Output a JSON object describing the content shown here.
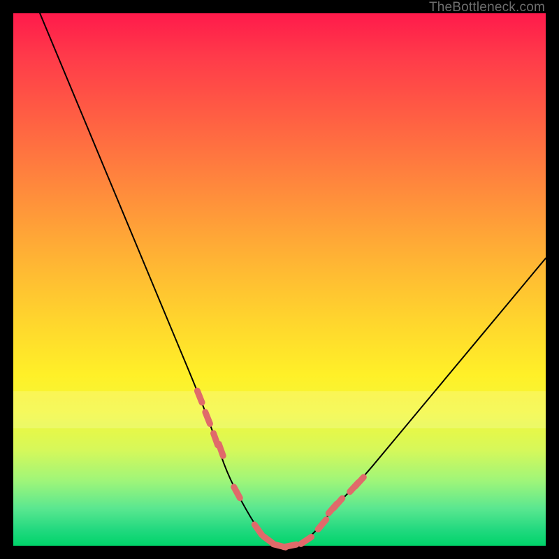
{
  "watermark": "TheBottleneck.com",
  "colors": {
    "frame": "#000000",
    "curve": "#000000",
    "marker": "#e06a6a",
    "gradient_top": "#ff1a4b",
    "gradient_bottom": "#00d46a"
  },
  "chart_data": {
    "type": "line",
    "title": "",
    "xlabel": "",
    "ylabel": "",
    "xlim": [
      0,
      100
    ],
    "ylim": [
      0,
      100
    ],
    "grid": false,
    "legend": false,
    "series": [
      {
        "name": "bottleneck-curve",
        "x": [
          5,
          10,
          15,
          20,
          25,
          30,
          35,
          38,
          40,
          43,
          46,
          48,
          50,
          52,
          55,
          58,
          60,
          65,
          70,
          75,
          80,
          85,
          90,
          95,
          100
        ],
        "y": [
          100,
          88,
          76,
          64,
          52,
          40,
          28,
          20,
          14,
          8,
          3,
          1,
          0,
          0,
          1,
          4,
          7,
          12,
          18,
          24,
          30,
          36,
          42,
          48,
          54
        ]
      }
    ],
    "markers": {
      "name": "highlight-points",
      "x": [
        35,
        36.5,
        38,
        39,
        42,
        46,
        48,
        50,
        52,
        55,
        58,
        60,
        61,
        64,
        65
      ],
      "y": [
        28,
        24,
        20,
        18,
        10,
        3,
        1,
        0,
        0,
        1,
        4,
        7,
        8,
        11,
        12
      ]
    },
    "pale_band": {
      "y_from": 22,
      "y_to": 29
    }
  }
}
